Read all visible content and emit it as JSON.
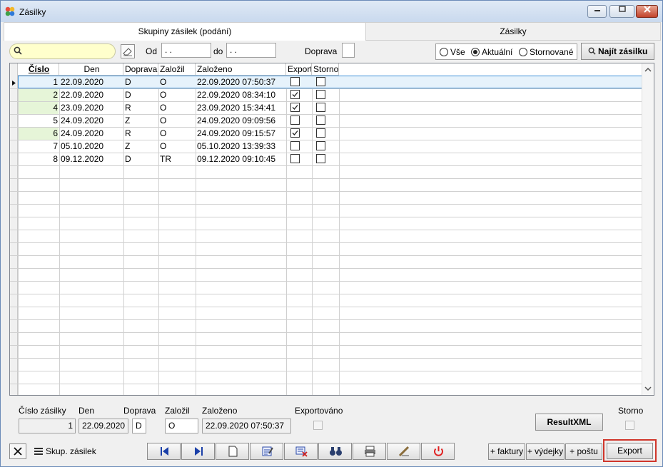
{
  "window": {
    "title": "Zásilky"
  },
  "tabs": [
    {
      "label": "Skupiny zásilek (podání)"
    },
    {
      "label": "Zásilky"
    }
  ],
  "filters": {
    "od_label": "Od",
    "od_value": " .  .",
    "do_label": "do",
    "do_value": " .  .",
    "doprava_label": "Doprava",
    "doprava_value": "",
    "radio_all": "Vše",
    "radio_current": "Aktuální",
    "radio_cancelled": "Stornované",
    "selected_radio": "Aktuální",
    "find_button": "Najít zásilku"
  },
  "table": {
    "columns": [
      "Číslo",
      "Den",
      "Doprava",
      "Založil",
      "Založeno",
      "Export",
      "Storno"
    ],
    "rows": [
      {
        "cislo": "1",
        "den": "22.09.2020",
        "doprava": "D",
        "zalozil": "O",
        "zalozeno": "22.09.2020 07:50:37",
        "export": false,
        "storno": false
      },
      {
        "cislo": "2",
        "den": "22.09.2020",
        "doprava": "D",
        "zalozil": "O",
        "zalozeno": "22.09.2020 08:34:10",
        "export": true,
        "storno": false
      },
      {
        "cislo": "4",
        "den": "23.09.2020",
        "doprava": "R",
        "zalozil": "O",
        "zalozeno": "23.09.2020 15:34:41",
        "export": true,
        "storno": false
      },
      {
        "cislo": "5",
        "den": "24.09.2020",
        "doprava": "Z",
        "zalozil": "O",
        "zalozeno": "24.09.2020 09:09:56",
        "export": false,
        "storno": false
      },
      {
        "cislo": "6",
        "den": "24.09.2020",
        "doprava": "R",
        "zalozil": "O",
        "zalozeno": "24.09.2020 09:15:57",
        "export": true,
        "storno": false
      },
      {
        "cislo": "7",
        "den": "05.10.2020",
        "doprava": "Z",
        "zalozil": "O",
        "zalozeno": "05.10.2020 13:39:33",
        "export": false,
        "storno": false
      },
      {
        "cislo": "8",
        "den": "09.12.2020",
        "doprava": "D",
        "zalozil": "TR",
        "zalozeno": "09.12.2020 09:10:45",
        "export": false,
        "storno": false
      }
    ]
  },
  "detail": {
    "cislo_label": "Číslo zásilky",
    "cislo_value": "1",
    "den_label": "Den",
    "den_value": "22.09.2020",
    "doprava_label": "Doprava",
    "doprava_value": "D",
    "zalozil_label": "Založil",
    "zalozil_value": "O",
    "zalozeno_label": "Založeno",
    "zalozeno_value": "22.09.2020 07:50:37",
    "exportovano_label": "Exportováno",
    "resultxml_button": "ResultXML",
    "storno_label": "Storno"
  },
  "footer": {
    "skup_label": "Skup. zásilek",
    "faktury_button": "+ faktury",
    "vydejky_button": "+ výdejky",
    "postu_button": "+ poštu",
    "export_button": "Export"
  },
  "colors": {
    "accent_border": "#d0352a",
    "green_row_marker": "#e6f5d8",
    "selected_row": "#cfe6fa"
  }
}
